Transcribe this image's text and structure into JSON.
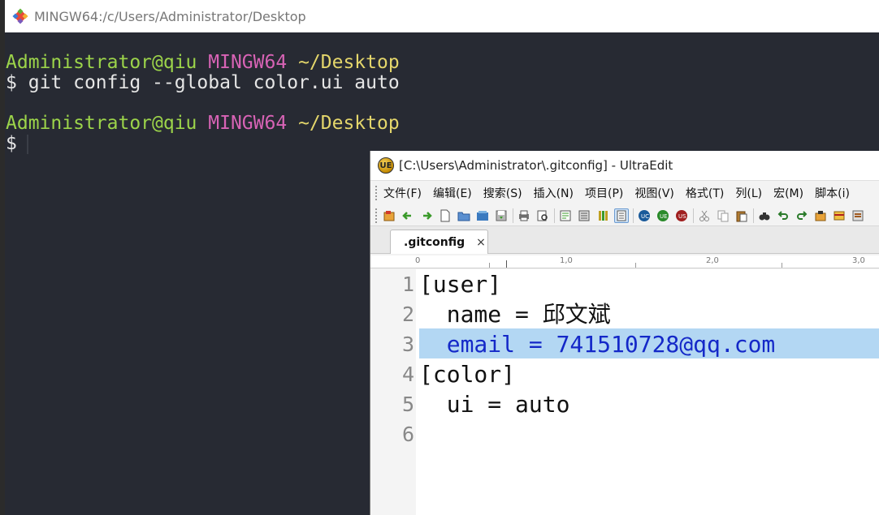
{
  "terminal": {
    "title": "MINGW64:/c/Users/Administrator/Desktop",
    "lines": [
      {
        "user_host": "Administrator@qiu",
        "system": "MINGW64",
        "cwd": "~/Desktop"
      },
      {
        "prompt": "$",
        "command": "git config --global color.ui auto"
      },
      {
        "user_host": "Administrator@qiu",
        "system": "MINGW64",
        "cwd": "~/Desktop"
      },
      {
        "prompt": "$",
        "command": ""
      }
    ],
    "colors": {
      "background": "#272a33",
      "user_host": "#9cd44a",
      "system": "#d763b5",
      "cwd": "#e4d66b",
      "text": "#e6e6e6"
    }
  },
  "editor": {
    "title": "[C:\\Users\\Administrator\\.gitconfig] - UltraEdit",
    "logo_text": "UE",
    "menu": [
      "文件(F)",
      "编辑(E)",
      "搜索(S)",
      "插入(N)",
      "项目(P)",
      "视图(V)",
      "格式(T)",
      "列(L)",
      "宏(M)",
      "脚本(i)"
    ],
    "toolbar_icons": [
      "open-icon",
      "back-icon",
      "forward-icon",
      "new-file-icon",
      "open-folder-icon",
      "close-file-icon",
      "save-icon",
      "print-icon",
      "print-preview-icon",
      "wordwrap-icon",
      "hex-icon",
      "column-mode-icon",
      "toggle-view-icon",
      "uc-icon",
      "ue-icon",
      "us-icon",
      "cut-icon",
      "copy-icon",
      "paste-icon",
      "find-icon",
      "undo-icon",
      "redo-icon",
      "macro-icon",
      "bookmark-icon",
      "settings-icon"
    ],
    "tab": {
      "label": ".gitconfig",
      "close": "×"
    },
    "ruler": {
      "labels": [
        "0",
        "1,0",
        "2,0",
        "3,0"
      ]
    },
    "lines": [
      {
        "number": "1",
        "text": "[user]"
      },
      {
        "number": "2",
        "text": "  name = 邱文斌"
      },
      {
        "number": "3",
        "text": "  email = 741510728@qq.com"
      },
      {
        "number": "4",
        "text": "[color]"
      },
      {
        "number": "5",
        "text": "  ui = auto"
      },
      {
        "number": "6",
        "text": ""
      }
    ],
    "selected_line": "3",
    "colors": {
      "selection": "#b3d7f3",
      "selected_text": "#1428c8"
    }
  }
}
